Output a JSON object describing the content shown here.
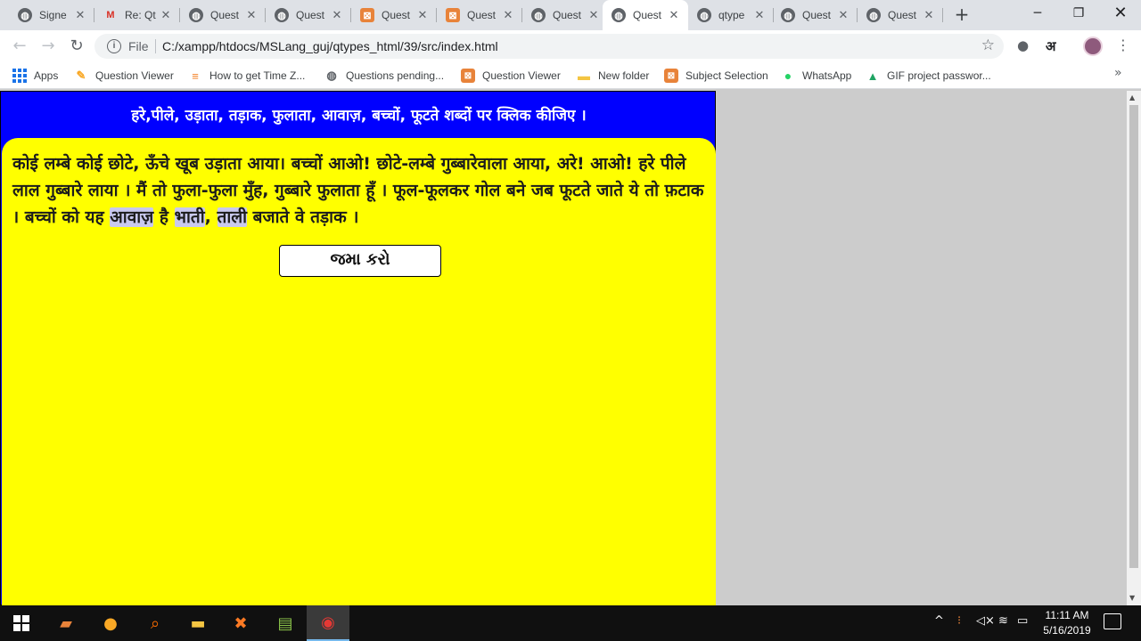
{
  "browser": {
    "tabs": [
      {
        "title": "Signe",
        "icon": "globe-icon"
      },
      {
        "title": "Re: Qt",
        "icon": "gmail-icon"
      },
      {
        "title": "Quest",
        "icon": "globe-icon"
      },
      {
        "title": "Quest",
        "icon": "globe-icon"
      },
      {
        "title": "Quest",
        "icon": "xampp-icon"
      },
      {
        "title": "Quest",
        "icon": "xampp-icon"
      },
      {
        "title": "Quest",
        "icon": "globe-icon"
      },
      {
        "title": "Quest",
        "icon": "globe-icon",
        "active": true
      },
      {
        "title": "qtype",
        "icon": "globe-icon"
      },
      {
        "title": "Quest",
        "icon": "globe-icon"
      },
      {
        "title": "Quest",
        "icon": "globe-icon"
      }
    ],
    "address": {
      "scheme_label": "File",
      "url": "C:/xampp/htdocs/MSLang_guj/qtypes_html/39/src/index.html"
    },
    "extension_label": "अ",
    "bookmarks": [
      {
        "label": "Apps",
        "icon": "apps-grid-icon"
      },
      {
        "label": "Question Viewer",
        "icon": "page-icon"
      },
      {
        "label": "How to get Time Z...",
        "icon": "stack-icon"
      },
      {
        "label": "Questions pending...",
        "icon": "globe-icon"
      },
      {
        "label": "Question Viewer",
        "icon": "xampp-icon"
      },
      {
        "label": "New folder",
        "icon": "folder-icon"
      },
      {
        "label": "Subject Selection",
        "icon": "xampp-icon"
      },
      {
        "label": "WhatsApp",
        "icon": "whatsapp-icon"
      },
      {
        "label": "GIF project passwor...",
        "icon": "drive-icon"
      }
    ]
  },
  "page": {
    "instruction": "हरे,पीले, उड़ाता, तड़ाक, फुलाता, आवाज़, बच्चों, फूटते शब्दों पर क्लिक कीजिए ।",
    "passage": [
      {
        "t": "कोई लम्बे कोई छोटे, ऊँचे खूब उड़ाता आया। बच्चों आओ! छोटे-लम्बे गुब्बारेवाला आया, अरे! आओ! हरे पीले लाल गुब्बारे लाया । मैं तो फुला-फुला मुँह, गुब्बारे फुलाता हूँ । फूल-फूलकर गोल बने जब फूटते जाते ये तो फ़टाक । बच्चों को यह ",
        "hl": false
      },
      {
        "t": "आवाज़",
        "hl": true
      },
      {
        "t": " है ",
        "hl": false
      },
      {
        "t": "भाती",
        "hl": true
      },
      {
        "t": ", ",
        "hl": false
      },
      {
        "t": "ताली",
        "hl": true
      },
      {
        "t": " बजाते वे तड़ाक ।",
        "hl": false
      }
    ],
    "submit_label": "જમા કરો",
    "highlight_color": "#c9c9ee",
    "panel_color": "#0000ff",
    "card_color": "#ffff00"
  },
  "taskbar": {
    "time": "11:11 AM",
    "date": "5/16/2019"
  }
}
